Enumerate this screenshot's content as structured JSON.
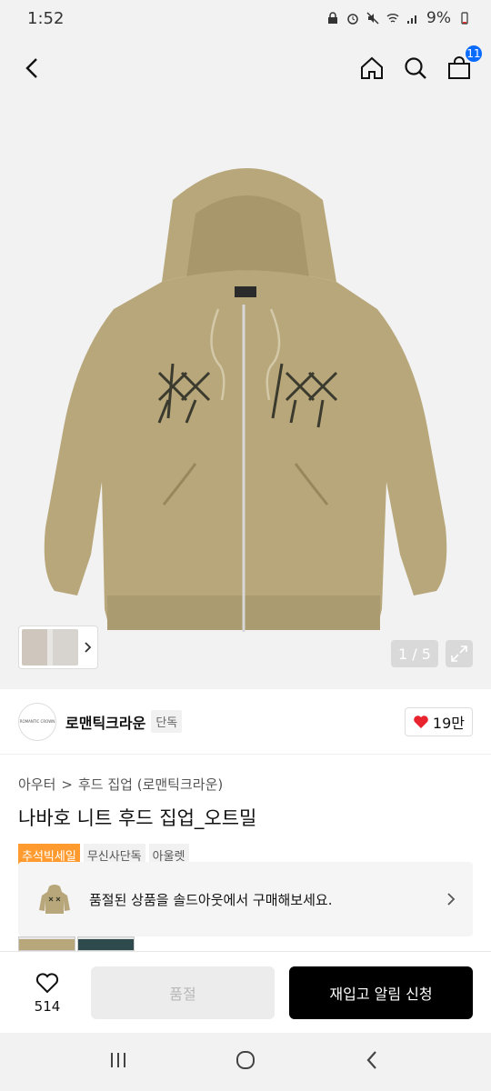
{
  "status_bar": {
    "time": "1:52",
    "battery": "9%"
  },
  "top_nav": {
    "cart_count": "11"
  },
  "gallery": {
    "counter": "1 / 5"
  },
  "brand": {
    "logo_text": "ROMANTIC CROWN",
    "name": "로맨틱크라운",
    "tag": "단독",
    "likes": "19만"
  },
  "breadcrumb": {
    "category": "아우터",
    "separator": ">",
    "subcategory": "후드 집업 (로맨틱크라운)"
  },
  "product": {
    "title": "나바호 니트 후드 집업_오트밀"
  },
  "tags": [
    "추석빅세일",
    "무신사단독",
    "아울렛"
  ],
  "soldout_banner": {
    "text": "품절된 상품을 솔드아웃에서 구매해보세요."
  },
  "bottom_bar": {
    "wish_count": "514",
    "soldout_label": "품절",
    "restock_label": "재입고 알림 신청"
  },
  "colors": {
    "accent": "#0a6cff",
    "tag_orange": "#ff9a2e",
    "heart": "#e8232e",
    "sweater": "#b8a77a"
  }
}
